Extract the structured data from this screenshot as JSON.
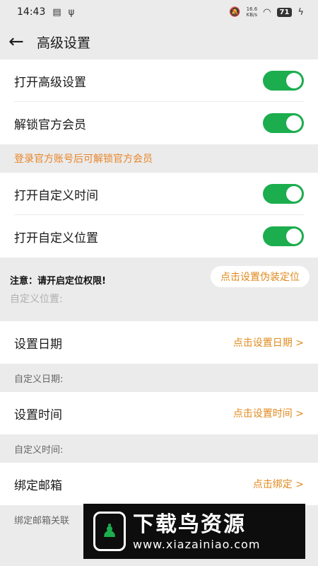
{
  "status": {
    "time": "14:43",
    "speed_value": "16.6",
    "speed_unit": "KB/s",
    "battery": "71"
  },
  "header": {
    "title": "高级设置"
  },
  "rows": {
    "open_advanced": "打开高级设置",
    "unlock_member": "解锁官方会员",
    "member_hint": "登录官方账号后可解锁官方会员",
    "custom_time": "打开自定义时间",
    "custom_location": "打开自定义位置"
  },
  "notice": {
    "text": "注意：请开启定位权限!",
    "button": "点击设置伪装定位",
    "custom_location_label": "自定义位置:"
  },
  "date": {
    "label": "设置日期",
    "action": "点击设置日期 >",
    "sub": "自定义日期:"
  },
  "time": {
    "label": "设置时间",
    "action": "点击设置时间 >",
    "sub": "自定义时间:"
  },
  "email": {
    "label": "绑定邮箱",
    "action": "点击绑定 >",
    "sub": "绑定邮箱关联"
  },
  "watermark": {
    "title": "下载鸟资源",
    "url": "www.xiazainiao.com"
  },
  "colors": {
    "toggle_on": "#1cad4e",
    "accent_orange": "#e08a1e"
  }
}
